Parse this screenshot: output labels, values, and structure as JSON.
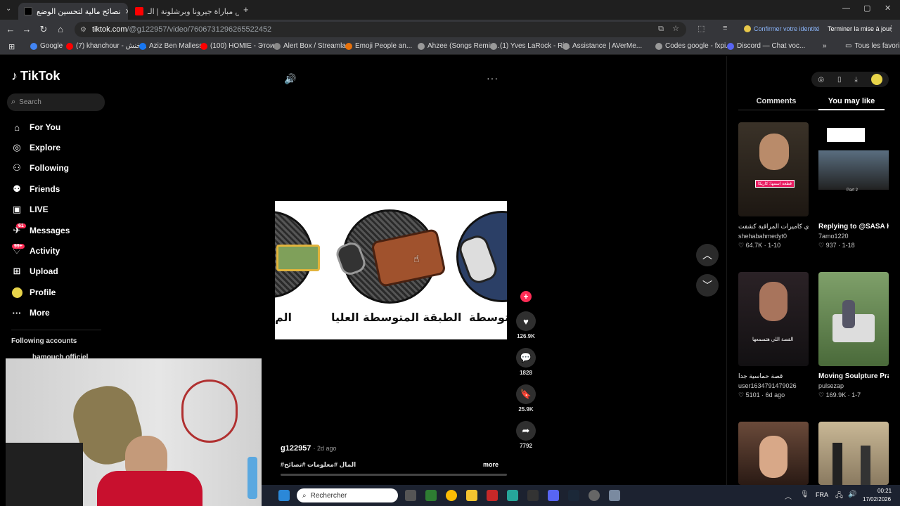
{
  "browser": {
    "tabs": [
      {
        "title": "نصائح مالية لتحسين الوضع",
        "active": true
      },
      {
        "title": "ملخص مباراة جيرونا وبرشلونة | الـ",
        "active": false
      }
    ],
    "url_host": "tiktok.com",
    "url_path": "/@g122957/video/7606731296265522452",
    "confirm_identity": "Confirmer votre identité",
    "finish_update": "Terminer la mise à jour",
    "bookmarks": [
      "Google",
      "(7) khanchour - خنش...",
      "Aziz Ben Mallessa",
      "(100) HOMIE - Этои...",
      "Alert Box / Streamla...",
      "Emoji People an...",
      "Ahzee (Songs Remix...",
      "(1) Yves LaRock - Ri...",
      "Assistance | AVerMe...",
      "Codes google - fxpi...",
      "Discord — Chat voc..."
    ],
    "all_bookmarks": "Tous les favoris"
  },
  "tiktok": {
    "logo": "TikTok",
    "search_placeholder": "Search",
    "nav": [
      {
        "label": "For You",
        "icon": "home-icon"
      },
      {
        "label": "Explore",
        "icon": "compass-icon"
      },
      {
        "label": "Following",
        "icon": "following-icon"
      },
      {
        "label": "Friends",
        "icon": "friends-icon"
      },
      {
        "label": "LIVE",
        "icon": "live-icon"
      },
      {
        "label": "Messages",
        "icon": "messages-icon",
        "badge": "61"
      },
      {
        "label": "Activity",
        "icon": "activity-icon",
        "badge": "99+"
      },
      {
        "label": "Upload",
        "icon": "upload-icon"
      },
      {
        "label": "Profile",
        "icon": "profile-avatar"
      },
      {
        "label": "More",
        "icon": "more-icon"
      }
    ],
    "following_accounts": "Following accounts",
    "following_first": "hamouch officiel",
    "video": {
      "label_center": "الطبقة المتوسطة العليا",
      "label_left": "الم",
      "label_right": "متوسطة",
      "author": "g122957",
      "age": "· 2d ago",
      "caption": "#المال #معلومات #نصائح",
      "more": "more"
    },
    "actions": {
      "likes": "126.9K",
      "comments": "1828",
      "saves": "25.9K",
      "shares": "7792"
    },
    "right": {
      "tabs": [
        "Comments",
        "You may like"
      ],
      "cards": [
        {
          "title": "شيطانة مسطرد: ازاي كاميرات المراقبة كشفت",
          "author": "shehabahmedyt0",
          "stats": "64.7K · 1-10",
          "thumb_text": "قطعة اسمها: كاريكا"
        },
        {
          "title": "Replying to @SASA KING 👑...",
          "author": "7amo1220",
          "stats": "937 · 1-18",
          "thumb_text": "Part 2"
        },
        {
          "title": "قصة حماسية جدا",
          "author": "user1634791479026",
          "stats": "5101 · 6d ago",
          "thumb_text": "القصة اللي هتسمعها"
        },
        {
          "title": "Moving Soulpture Pranks 🤣🤣 ...",
          "author": "pulsezap",
          "stats": "169.9K · 1-7",
          "thumb_text": ""
        },
        {
          "title": "",
          "author": "",
          "stats": "",
          "thumb_text": ""
        },
        {
          "title": "",
          "author": "",
          "stats": "",
          "thumb_text": ""
        }
      ]
    }
  },
  "taskbar": {
    "search": "Rechercher",
    "lang": "FRA",
    "time": "00:21",
    "date": "17/02/2026"
  }
}
